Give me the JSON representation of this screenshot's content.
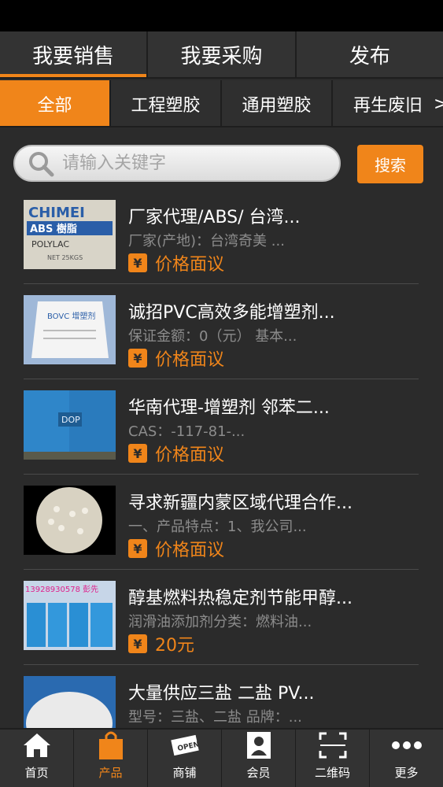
{
  "top_tabs": [
    {
      "label": "我要销售"
    },
    {
      "label": "我要采购"
    },
    {
      "label": "发布"
    }
  ],
  "categories": {
    "prev": "<",
    "next": ">",
    "items": [
      {
        "label": "全部"
      },
      {
        "label": "工程塑胶"
      },
      {
        "label": "通用塑胶"
      },
      {
        "label": "再生废旧"
      }
    ]
  },
  "search": {
    "placeholder": "请输入关键字",
    "value": "",
    "button_label": "搜索"
  },
  "products": [
    {
      "title": "厂家代理/ABS/ 台湾...",
      "desc": "厂家(产地)：台湾奇美 ...",
      "yen": "¥",
      "price": "价格面议",
      "thumb_text": "CHIMEI ABS 樹脂 POLYLAC NET 25KGS"
    },
    {
      "title": "诚招PVC高效多能增塑剂...",
      "desc": "保证金额：0（元） 基本...",
      "yen": "¥",
      "price": "价格面议",
      "thumb_text": "BOVC 增塑剂"
    },
    {
      "title": "华南代理-增塑剂 邻苯二...",
      "desc": "CAS：-117-81-...",
      "yen": "¥",
      "price": "价格面议",
      "thumb_text": "DOP"
    },
    {
      "title": "寻求新疆内蒙区域代理合作...",
      "desc": "一、产品特点：1、我公司...",
      "yen": "¥",
      "price": "价格面议",
      "thumb_text": ""
    },
    {
      "title": "醇基燃料热稳定剂节能甲醇...",
      "desc": "润滑油添加剂分类：燃料油...",
      "yen": "¥",
      "price": "20元",
      "thumb_text": "13928930578 彭先"
    },
    {
      "title": "大量供应三盐 二盐 PV...",
      "desc": "型号：三盐、二盐 品牌：...",
      "yen": "¥",
      "price": "",
      "thumb_text": ""
    }
  ],
  "bottom_nav": [
    {
      "label": "首页",
      "icon": "home-icon"
    },
    {
      "label": "产品",
      "icon": "bag-icon"
    },
    {
      "label": "商铺",
      "icon": "shop-icon"
    },
    {
      "label": "会员",
      "icon": "member-icon"
    },
    {
      "label": "二维码",
      "icon": "qr-icon"
    },
    {
      "label": "更多",
      "icon": "more-icon"
    }
  ],
  "colors": {
    "accent": "#f0851a",
    "background": "#2b2b2b",
    "bar": "#333333"
  }
}
